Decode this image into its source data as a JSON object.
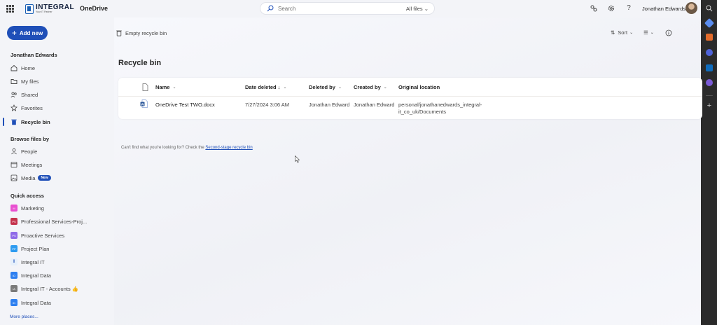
{
  "app": {
    "logo_text": "INTEGRAL",
    "logo_tagline": "Your IT Partner",
    "name": "OneDrive"
  },
  "search": {
    "placeholder": "Search",
    "scope": "All files"
  },
  "user": {
    "name": "Jonathan Edwards"
  },
  "sidebar": {
    "add_label": "Add new",
    "account_title": "Jonathan Edwards",
    "items": [
      {
        "label": "Home",
        "icon": "home-icon"
      },
      {
        "label": "My files",
        "icon": "folder-icon"
      },
      {
        "label": "Shared",
        "icon": "people-icon"
      },
      {
        "label": "Favorites",
        "icon": "star-icon"
      },
      {
        "label": "Recycle bin",
        "icon": "trash-icon"
      }
    ],
    "browse_title": "Browse files by",
    "browse_items": [
      {
        "label": "People",
        "icon": "person-icon"
      },
      {
        "label": "Meetings",
        "icon": "calendar-icon"
      },
      {
        "label": "Media",
        "icon": "image-icon",
        "badge": "New"
      }
    ],
    "quick_title": "Quick access",
    "quick_items": [
      {
        "label": "Marketing",
        "color": "#e84fd0"
      },
      {
        "label": "Professional Services-Proj...",
        "color": "#c4314b"
      },
      {
        "label": "Proactive Services",
        "color": "#8f6be8"
      },
      {
        "label": "Project Plan",
        "color": "#2d9bf0"
      },
      {
        "label": "Integral IT",
        "color": "#e6f0fb"
      },
      {
        "label": "Integral Data",
        "color": "#2d7ff0"
      },
      {
        "label": "Integral IT - Accounts 👍",
        "color": "#7a7a7a"
      },
      {
        "label": "Integral Data",
        "color": "#2d7ff0"
      }
    ],
    "more_label": "More places..."
  },
  "toolbar": {
    "empty_bin": "Empty recycle bin",
    "sort": "Sort"
  },
  "page": {
    "title": "Recycle bin"
  },
  "table": {
    "columns": [
      "Name",
      "Date deleted ↓",
      "Deleted by",
      "Created by",
      "Original location"
    ],
    "rows": [
      {
        "name": "OneDrive Test TWO.docx",
        "date_deleted": "7/27/2024 3:06 AM",
        "deleted_by": "Jonathan Edwards",
        "created_by": "Jonathan Edwards",
        "location_line1": "personal/jonathanedwards_integral-",
        "location_line2": "it_co_uk/Documents"
      }
    ]
  },
  "footer": {
    "note": "Can't find what you're looking for? Check the",
    "link": "Second-stage recycle bin"
  }
}
